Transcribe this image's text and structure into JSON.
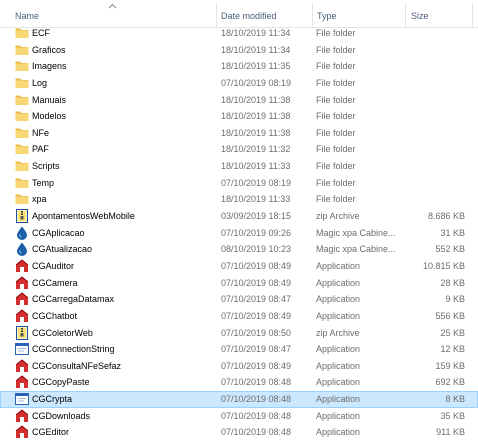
{
  "columns": {
    "name": "Name",
    "date": "Date modified",
    "type": "Type",
    "size": "Size"
  },
  "files": [
    {
      "name": "ECF",
      "date": "18/10/2019 11:34",
      "type": "File folder",
      "size": "",
      "icon": "folder-icon"
    },
    {
      "name": "Graficos",
      "date": "18/10/2019 11:34",
      "type": "File folder",
      "size": "",
      "icon": "folder-icon"
    },
    {
      "name": "Imagens",
      "date": "18/10/2019 11:35",
      "type": "File folder",
      "size": "",
      "icon": "folder-icon"
    },
    {
      "name": "Log",
      "date": "07/10/2019 08:19",
      "type": "File folder",
      "size": "",
      "icon": "folder-icon"
    },
    {
      "name": "Manuais",
      "date": "18/10/2019 11:38",
      "type": "File folder",
      "size": "",
      "icon": "folder-icon"
    },
    {
      "name": "Modelos",
      "date": "18/10/2019 11:38",
      "type": "File folder",
      "size": "",
      "icon": "folder-icon"
    },
    {
      "name": "NFe",
      "date": "18/10/2019 11:38",
      "type": "File folder",
      "size": "",
      "icon": "folder-icon"
    },
    {
      "name": "PAF",
      "date": "18/10/2019 11:32",
      "type": "File folder",
      "size": "",
      "icon": "folder-icon"
    },
    {
      "name": "Scripts",
      "date": "18/10/2019 11:33",
      "type": "File folder",
      "size": "",
      "icon": "folder-icon"
    },
    {
      "name": "Temp",
      "date": "07/10/2019 08:19",
      "type": "File folder",
      "size": "",
      "icon": "folder-icon"
    },
    {
      "name": "xpa",
      "date": "18/10/2019 11:33",
      "type": "File folder",
      "size": "",
      "icon": "folder-icon"
    },
    {
      "name": "ApontamentosWebMobile",
      "date": "03/09/2019 18:15",
      "type": "zip Archive",
      "size": "8.686 KB",
      "icon": "zip-archive-icon"
    },
    {
      "name": "CGAplicacao",
      "date": "07/10/2019 09:26",
      "type": "Magic xpa Cabine...",
      "size": "31 KB",
      "icon": "magic-xpa-drop-icon"
    },
    {
      "name": "CGAtualizacao",
      "date": "08/10/2019 10:23",
      "type": "Magic xpa Cabine...",
      "size": "552 KB",
      "icon": "magic-xpa-drop-icon"
    },
    {
      "name": "CGAuditor",
      "date": "07/10/2019 08:49",
      "type": "Application",
      "size": "10.815 KB",
      "icon": "app-red-icon"
    },
    {
      "name": "CGCamera",
      "date": "07/10/2019 08:49",
      "type": "Application",
      "size": "28 KB",
      "icon": "app-red-icon"
    },
    {
      "name": "CGCarregaDatamax",
      "date": "07/10/2019 08:47",
      "type": "Application",
      "size": "9 KB",
      "icon": "app-red-icon"
    },
    {
      "name": "CGChatbot",
      "date": "07/10/2019 08:49",
      "type": "Application",
      "size": "556 KB",
      "icon": "app-red-icon"
    },
    {
      "name": "CGColetorWeb",
      "date": "07/10/2019 08:50",
      "type": "zip Archive",
      "size": "25 KB",
      "icon": "zip-archive-icon"
    },
    {
      "name": "CGConnectionString",
      "date": "07/10/2019 08:47",
      "type": "Application",
      "size": "12 KB",
      "icon": "app-window-icon"
    },
    {
      "name": "CGConsultaNFeSefaz",
      "date": "07/10/2019 08:49",
      "type": "Application",
      "size": "159 KB",
      "icon": "app-red-icon"
    },
    {
      "name": "CGCopyPaste",
      "date": "07/10/2019 08:48",
      "type": "Application",
      "size": "692 KB",
      "icon": "app-red-icon"
    },
    {
      "name": "CGCrypta",
      "date": "07/10/2019 08:48",
      "type": "Application",
      "size": "8 KB",
      "icon": "app-window-icon"
    },
    {
      "name": "CGDownloads",
      "date": "07/10/2019 08:48",
      "type": "Application",
      "size": "35 KB",
      "icon": "app-red-icon"
    },
    {
      "name": "CGEditor",
      "date": "07/10/2019 08:48",
      "type": "Application",
      "size": "911 KB",
      "icon": "app-red-icon"
    }
  ],
  "selected_index": 22,
  "colors": {
    "header_text": "#4c607a",
    "folder": "#f8d775",
    "selection": "#cce8ff",
    "selection_border": "#99d1ff",
    "detail_text": "#6d6d6d"
  }
}
